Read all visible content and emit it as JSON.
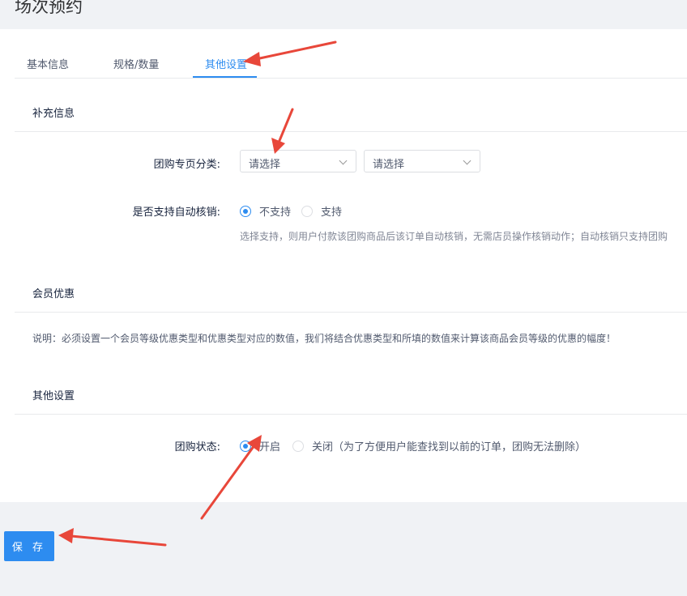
{
  "page": {
    "title": "场次预约"
  },
  "tabs": [
    {
      "label": "基本信息"
    },
    {
      "label": "规格/数量"
    },
    {
      "label": "其他设置"
    }
  ],
  "supplementary": {
    "title": "补充信息",
    "category_label": "团购专页分类:",
    "select1_placeholder": "请选择",
    "select2_placeholder": "请选择",
    "auto_verify_label": "是否支持自动核销:",
    "auto_verify_options": [
      "不支持",
      "支持"
    ],
    "auto_verify_hint": "选择支持，则用户付款该团购商品后该订单自动核销，无需店员操作核销动作；自动核销只支持团购"
  },
  "member": {
    "title": "会员优惠",
    "note": "说明：必须设置一个会员等级优惠类型和优惠类型对应的数值，我们将结合优惠类型和所填的数值来计算该商品会员等级的优惠的幅度！"
  },
  "other": {
    "title": "其他设置",
    "status_label": "团购状态:",
    "status_options": [
      "开启",
      "关闭（为了方便用户能查找到以前的订单，团购无法删除）"
    ]
  },
  "footer": {
    "save_label": "保 存"
  },
  "colors": {
    "accent": "#2d8cf0",
    "annotation": "#e8473a"
  }
}
